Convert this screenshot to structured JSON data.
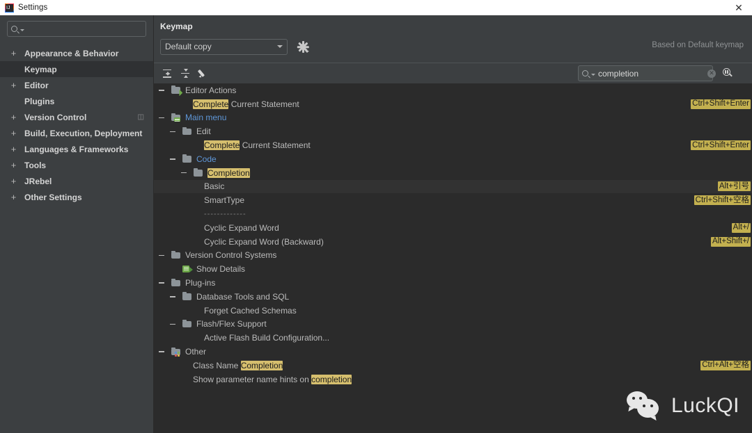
{
  "window": {
    "title": "Settings",
    "close_label": "✕",
    "app_icon": "intellij-icon"
  },
  "sidebar": {
    "search": {
      "value": "",
      "placeholder": ""
    },
    "items": [
      {
        "label": "Appearance & Behavior",
        "expander": "+",
        "selected": false,
        "trailing": ""
      },
      {
        "label": "Keymap",
        "expander": "",
        "selected": true,
        "trailing": ""
      },
      {
        "label": "Editor",
        "expander": "+",
        "selected": false,
        "trailing": ""
      },
      {
        "label": "Plugins",
        "expander": "",
        "selected": false,
        "trailing": ""
      },
      {
        "label": "Version Control",
        "expander": "+",
        "selected": false,
        "trailing": "◫"
      },
      {
        "label": "Build, Execution, Deployment",
        "expander": "+",
        "selected": false,
        "trailing": ""
      },
      {
        "label": "Languages & Frameworks",
        "expander": "+",
        "selected": false,
        "trailing": ""
      },
      {
        "label": "Tools",
        "expander": "+",
        "selected": false,
        "trailing": ""
      },
      {
        "label": "JRebel",
        "expander": "+",
        "selected": false,
        "trailing": ""
      },
      {
        "label": "Other Settings",
        "expander": "+",
        "selected": false,
        "trailing": ""
      }
    ]
  },
  "panel": {
    "title": "Keymap",
    "keymap_select": {
      "value": "Default copy"
    },
    "gear_icon": "gear-icon",
    "based_on": "Based on Default keymap",
    "toolbar": [
      {
        "icon": "expand-all-icon",
        "name": "expand-all-button"
      },
      {
        "icon": "collapse-all-icon",
        "name": "collapse-all-button"
      },
      {
        "icon": "edit-pencil-icon",
        "name": "edit-shortcut-button"
      }
    ],
    "find": {
      "value": "completion",
      "placeholder": "",
      "clear_label": "✕"
    },
    "find_by_shortcut_icon": "find-by-shortcut-icon"
  },
  "tree": {
    "rows": [
      {
        "indent": 0,
        "handle": "minus",
        "icon": "editor-actions-folder-icon",
        "segments": [
          {
            "t": "Editor Actions",
            "h": false
          }
        ],
        "blue": false,
        "shortcut": "",
        "selected": false
      },
      {
        "indent": 2,
        "handle": "",
        "icon": "",
        "segments": [
          {
            "t": "Complete",
            "h": true
          },
          {
            "t": " Current Statement",
            "h": false
          }
        ],
        "blue": false,
        "shortcut": "Ctrl+Shift+Enter",
        "selected": false
      },
      {
        "indent": 0,
        "handle": "minus",
        "icon": "main-menu-folder-icon",
        "segments": [
          {
            "t": "Main menu",
            "h": false
          }
        ],
        "blue": true,
        "shortcut": "",
        "selected": false
      },
      {
        "indent": 1,
        "handle": "minus",
        "icon": "folder-icon",
        "segments": [
          {
            "t": "Edit",
            "h": false
          }
        ],
        "blue": false,
        "shortcut": "",
        "selected": false
      },
      {
        "indent": 3,
        "handle": "",
        "icon": "",
        "segments": [
          {
            "t": "Complete",
            "h": true
          },
          {
            "t": " Current Statement",
            "h": false
          }
        ],
        "blue": false,
        "shortcut": "Ctrl+Shift+Enter",
        "selected": false
      },
      {
        "indent": 1,
        "handle": "minus",
        "icon": "folder-icon",
        "segments": [
          {
            "t": "Code",
            "h": false
          }
        ],
        "blue": true,
        "shortcut": "",
        "selected": false
      },
      {
        "indent": 2,
        "handle": "minus",
        "icon": "folder-icon",
        "segments": [
          {
            "t": "Completion",
            "h": true
          }
        ],
        "blue": false,
        "shortcut": "",
        "selected": false
      },
      {
        "indent": 3,
        "handle": "",
        "icon": "",
        "segments": [
          {
            "t": "Basic",
            "h": false
          }
        ],
        "blue": false,
        "shortcut": "Alt+引号",
        "selected": true
      },
      {
        "indent": 3,
        "handle": "",
        "icon": "",
        "segments": [
          {
            "t": "SmartType",
            "h": false
          }
        ],
        "blue": false,
        "shortcut": "Ctrl+Shift+空格",
        "selected": false
      },
      {
        "indent": 3,
        "handle": "",
        "icon": "",
        "segments": [
          {
            "t": "-------------",
            "h": false
          }
        ],
        "blue": false,
        "shortcut": "",
        "selected": false,
        "separator": true
      },
      {
        "indent": 3,
        "handle": "",
        "icon": "",
        "segments": [
          {
            "t": "Cyclic Expand Word",
            "h": false
          }
        ],
        "blue": false,
        "shortcut": "Alt+/",
        "selected": false
      },
      {
        "indent": 3,
        "handle": "",
        "icon": "",
        "segments": [
          {
            "t": "Cyclic Expand Word (Backward)",
            "h": false
          }
        ],
        "blue": false,
        "shortcut": "Alt+Shift+/",
        "selected": false
      },
      {
        "indent": 0,
        "handle": "minus",
        "icon": "folder-icon",
        "segments": [
          {
            "t": "Version Control Systems",
            "h": false
          }
        ],
        "blue": false,
        "shortcut": "",
        "selected": false
      },
      {
        "indent": 1,
        "handle": "",
        "icon": "show-details-icon",
        "segments": [
          {
            "t": "Show Details",
            "h": false
          }
        ],
        "blue": false,
        "shortcut": "",
        "selected": false
      },
      {
        "indent": 0,
        "handle": "minus",
        "icon": "folder-icon",
        "segments": [
          {
            "t": "Plug-ins",
            "h": false
          }
        ],
        "blue": false,
        "shortcut": "",
        "selected": false
      },
      {
        "indent": 1,
        "handle": "minus",
        "icon": "folder-icon",
        "segments": [
          {
            "t": "Database Tools and SQL",
            "h": false
          }
        ],
        "blue": false,
        "shortcut": "",
        "selected": false
      },
      {
        "indent": 3,
        "handle": "",
        "icon": "",
        "segments": [
          {
            "t": "Forget Cached Schemas",
            "h": false
          }
        ],
        "blue": false,
        "shortcut": "",
        "selected": false
      },
      {
        "indent": 1,
        "handle": "minus",
        "icon": "folder-icon",
        "segments": [
          {
            "t": "Flash/Flex Support",
            "h": false
          }
        ],
        "blue": false,
        "shortcut": "",
        "selected": false
      },
      {
        "indent": 3,
        "handle": "",
        "icon": "",
        "segments": [
          {
            "t": "Active Flash Build Configuration...",
            "h": false
          }
        ],
        "blue": false,
        "shortcut": "",
        "selected": false
      },
      {
        "indent": 0,
        "handle": "minus",
        "icon": "other-folder-icon",
        "segments": [
          {
            "t": "Other",
            "h": false
          }
        ],
        "blue": false,
        "shortcut": "",
        "selected": false
      },
      {
        "indent": 2,
        "handle": "",
        "icon": "",
        "segments": [
          {
            "t": "Class Name ",
            "h": false
          },
          {
            "t": "Completion",
            "h": true
          }
        ],
        "blue": false,
        "shortcut": "Ctrl+Alt+空格",
        "selected": false
      },
      {
        "indent": 2,
        "handle": "",
        "icon": "",
        "segments": [
          {
            "t": "Show parameter name hints on ",
            "h": false
          },
          {
            "t": "completion",
            "h": true
          }
        ],
        "blue": false,
        "shortcut": "",
        "selected": false
      }
    ]
  },
  "watermark": {
    "text": "LuckQI",
    "icon": "wechat-icon"
  },
  "colors": {
    "window_bg": "#3c3f41",
    "tree_bg": "#2b2b2b",
    "highlight": "#d6bf6e",
    "shortcut_bg": "#c3b04f",
    "link_blue": "#5f97d8"
  }
}
